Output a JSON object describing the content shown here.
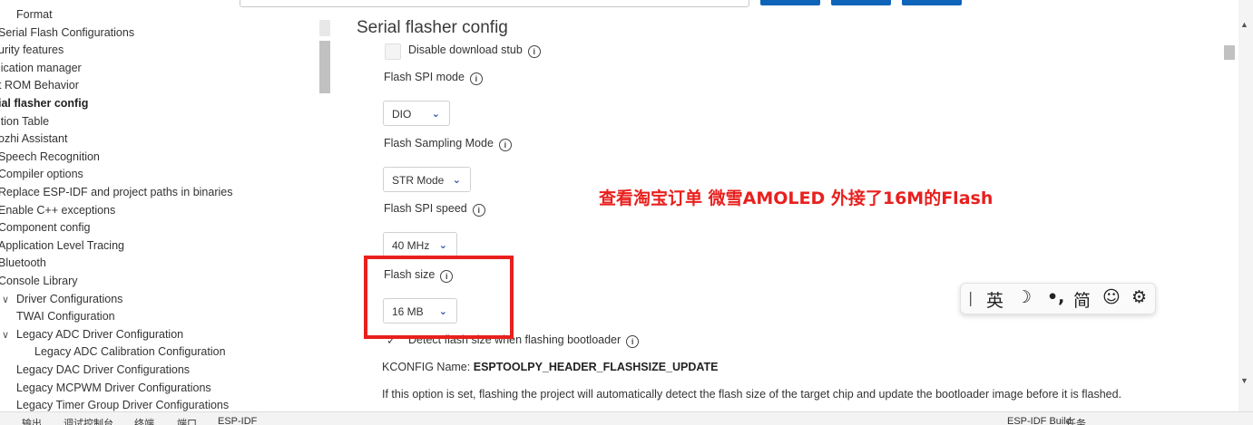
{
  "tree": {
    "items": [
      {
        "label": "Format",
        "indent": 1
      },
      {
        "label": "Serial Flash Configurations",
        "indent": 0
      },
      {
        "label": "urity features",
        "indent": 0
      },
      {
        "label": "lication manager",
        "indent": 0
      },
      {
        "label": "t ROM Behavior",
        "indent": 0
      },
      {
        "label": "ial flasher config",
        "indent": 0,
        "bold": true
      },
      {
        "label": "ition Table",
        "indent": 0
      },
      {
        "label": "ozhi Assistant",
        "indent": 0
      },
      {
        "label": "Speech Recognition",
        "indent": 0
      },
      {
        "label": "Compiler options",
        "indent": 0
      },
      {
        "label": "Replace ESP-IDF and project paths in binaries",
        "indent": 0
      },
      {
        "label": "Enable C++ exceptions",
        "indent": 0
      },
      {
        "label": "Component config",
        "indent": 0
      },
      {
        "label": "Application Level Tracing",
        "indent": 0
      },
      {
        "label": "Bluetooth",
        "indent": 0
      },
      {
        "label": "Console Library",
        "indent": 0
      },
      {
        "label": "Driver Configurations",
        "indent": 1,
        "chevron": true
      },
      {
        "label": "TWAI Configuration",
        "indent": 2
      },
      {
        "label": "Legacy ADC Driver Configuration",
        "indent": 2,
        "chevron": true
      },
      {
        "label": "Legacy ADC Calibration Configuration",
        "indent": 3
      },
      {
        "label": "Legacy DAC Driver Configurations",
        "indent": 2
      },
      {
        "label": "Legacy MCPWM Driver Configurations",
        "indent": 2
      },
      {
        "label": "Legacy Timer Group Driver Configurations",
        "indent": 2
      }
    ]
  },
  "main": {
    "title": "Serial flasher config",
    "disable_stub_label": "Disable download stub",
    "flash_spi_mode_label": "Flash SPI mode",
    "flash_spi_mode_value": "DIO",
    "flash_sampling_label": "Flash Sampling Mode",
    "flash_sampling_value": "STR Mode",
    "flash_spi_speed_label": "Flash SPI speed",
    "flash_spi_speed_value": "40 MHz",
    "flash_size_label": "Flash size",
    "flash_size_value": "16 MB",
    "detect_label": "Detect flash size when flashing bootloader",
    "kconfig_prefix": "KCONFIG Name:",
    "kconfig_name": "ESPTOOLPY_HEADER_FLASHSIZE_UPDATE",
    "description": "If this option is set, flashing the project will automatically detect the flash size of the target chip and update the bootloader image before it is flashed."
  },
  "annotation": {
    "text": "查看淘宝订单 微雪AMOLED 外接了16M的Flash",
    "color": "#e8201e"
  },
  "ime": {
    "mode": "英",
    "moon": "☽",
    "punct": "•,",
    "simplified": "简",
    "emoji": "☺",
    "settings": "⚙"
  },
  "statusbar": {
    "items": [
      "输出",
      "调试控制台",
      "终端",
      "端口",
      "ESP-IDF",
      "ESP-IDF Build",
      "任务"
    ]
  },
  "colors": {
    "accent": "#0e64b8",
    "highlight": "#e8201e"
  }
}
